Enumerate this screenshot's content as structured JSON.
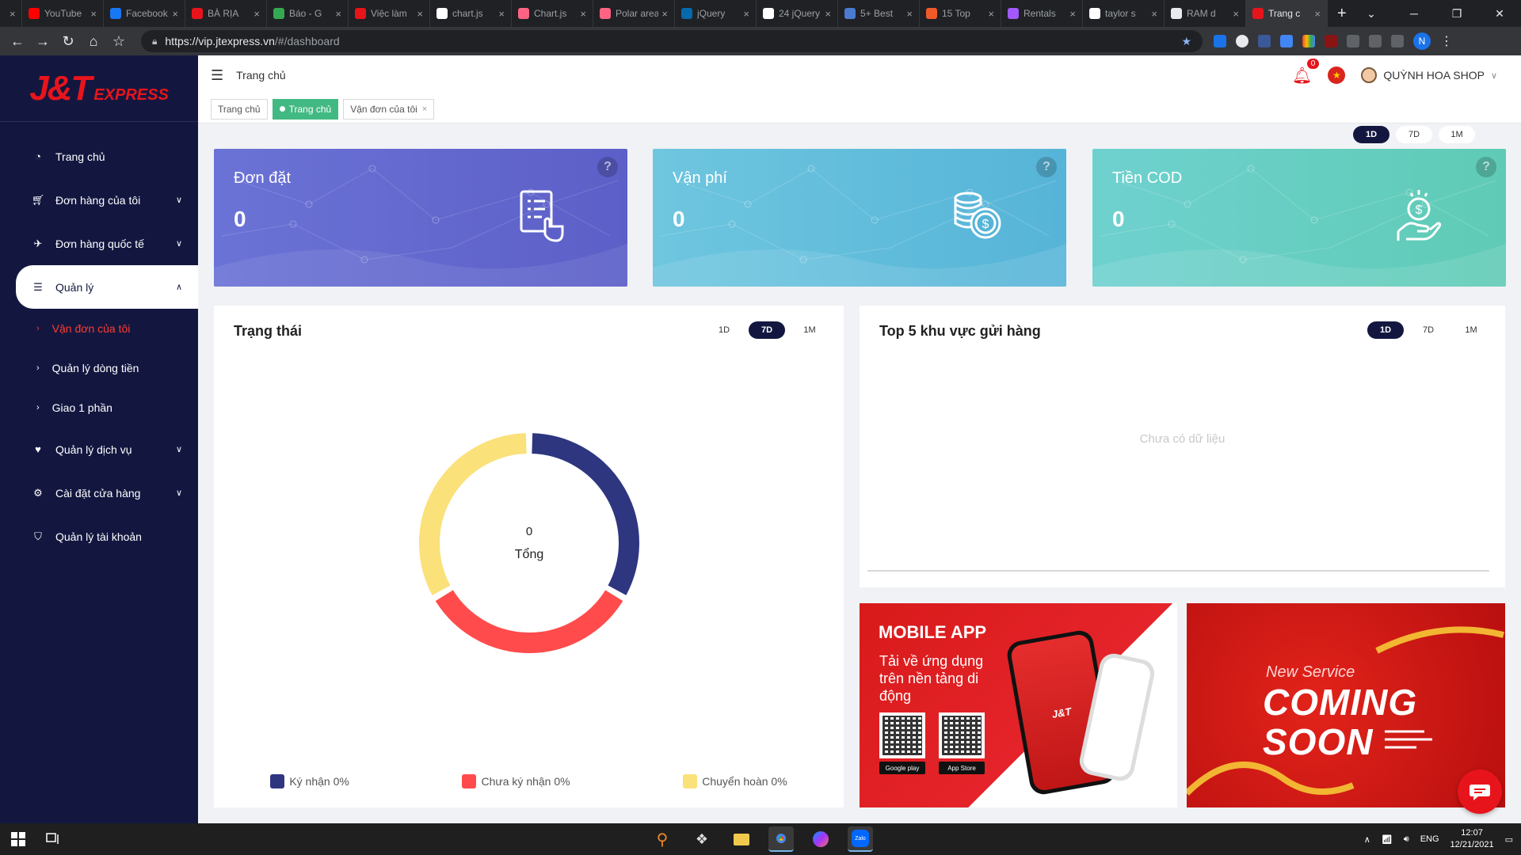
{
  "browser": {
    "tabs": [
      {
        "label": "",
        "fav": "#202124"
      },
      {
        "label": "YouTube",
        "fav": "#ff0000"
      },
      {
        "label": "Facebook",
        "fav": "#1877f2"
      },
      {
        "label": "BÀ RỊA",
        "fav": "#e8141b"
      },
      {
        "label": "Báo - G",
        "fav": "#34a853"
      },
      {
        "label": "Việc làm",
        "fav": "#e8141b"
      },
      {
        "label": "chart.js",
        "fav": "#ffffff"
      },
      {
        "label": "Chart.js",
        "fav": "#ff6384"
      },
      {
        "label": "Polar area",
        "fav": "#ff6384"
      },
      {
        "label": "jQuery",
        "fav": "#0769ad"
      },
      {
        "label": "24 jQuery",
        "fav": "#ffffff"
      },
      {
        "label": "5+ Best",
        "fav": "#4a7bd0"
      },
      {
        "label": "15 Top",
        "fav": "#f05a28"
      },
      {
        "label": "Rentals",
        "fav": "#a259ff"
      },
      {
        "label": "taylor s",
        "fav": "#ffffff"
      },
      {
        "label": "RAM d",
        "fav": "#e8eaed"
      },
      {
        "label": "Trang c",
        "fav": "#e8141b"
      }
    ],
    "new_tab": "+",
    "url_host": "https://vip.jtexpress.vn",
    "url_path": "/#/dashboard",
    "profile_initial": "N"
  },
  "sidebar": {
    "logo_main": "J&T",
    "logo_sub": "EXPRESS",
    "items": [
      {
        "label": "Trang chủ",
        "icon": "dashboard-icon",
        "chevron": false
      },
      {
        "label": "Đơn hàng của tôi",
        "icon": "cart-icon",
        "chevron": true
      },
      {
        "label": "Đơn hàng quốc tế",
        "icon": "plane-icon",
        "chevron": true
      },
      {
        "label": "Quản lý",
        "icon": "list-icon",
        "chevron": true
      }
    ],
    "submenu": [
      {
        "label": "Vận đơn của tôi"
      },
      {
        "label": "Quản lý dòng tiền"
      },
      {
        "label": "Giao 1 phần"
      }
    ],
    "items_after": [
      {
        "label": "Quản lý dịch vụ",
        "icon": "heart-icon",
        "chevron": true
      },
      {
        "label": "Cài đặt cửa hàng",
        "icon": "user-settings-icon",
        "chevron": true
      },
      {
        "label": "Quản lý tài khoản",
        "icon": "shield-icon",
        "chevron": false
      }
    ]
  },
  "header": {
    "title": "Trang chủ",
    "notif_count": "0",
    "user_name": "QUỲNH HOA SHOP",
    "breadcrumbs": [
      {
        "label": "Trang chủ",
        "active": false,
        "closable": false
      },
      {
        "label": "Trang chủ",
        "active": true,
        "closable": false
      },
      {
        "label": "Vận đơn của tôi",
        "active": false,
        "closable": true
      }
    ]
  },
  "periods": [
    "1D",
    "7D",
    "1M"
  ],
  "stat_cards": [
    {
      "title": "Đơn đặt",
      "value": "0",
      "icon": "order-list-icon"
    },
    {
      "title": "Vận phí",
      "value": "0",
      "icon": "coins-icon"
    },
    {
      "title": "Tiền COD",
      "value": "0",
      "icon": "cash-hand-icon"
    }
  ],
  "status_panel": {
    "title": "Trạng thái",
    "selected_period": "7D",
    "center_value": "0",
    "center_label": "Tổng",
    "chart_data": {
      "type": "pie",
      "categories": [
        "Ký nhận 0%",
        "Chưa ký nhận 0%",
        "Chuyển hoàn 0%"
      ],
      "values": [
        1,
        1,
        1
      ],
      "colors": [
        "#2e3680",
        "#ff4b4b",
        "#fae17a"
      ]
    }
  },
  "top5_panel": {
    "title": "Top 5 khu vực gửi hàng",
    "selected_period": "1D",
    "empty_text": "Chưa có dữ liệu"
  },
  "mobile_banner": {
    "title": "MOBILE APP",
    "subtitle": "Tải về ứng dụng trên nền tảng di động",
    "google_play": "Google play",
    "app_store": "App Store"
  },
  "soon_banner": {
    "kicker": "New Service",
    "headline": "COMING SOON"
  },
  "taskbar": {
    "lang": "ENG",
    "time": "12:07",
    "date": "12/21/2021"
  }
}
